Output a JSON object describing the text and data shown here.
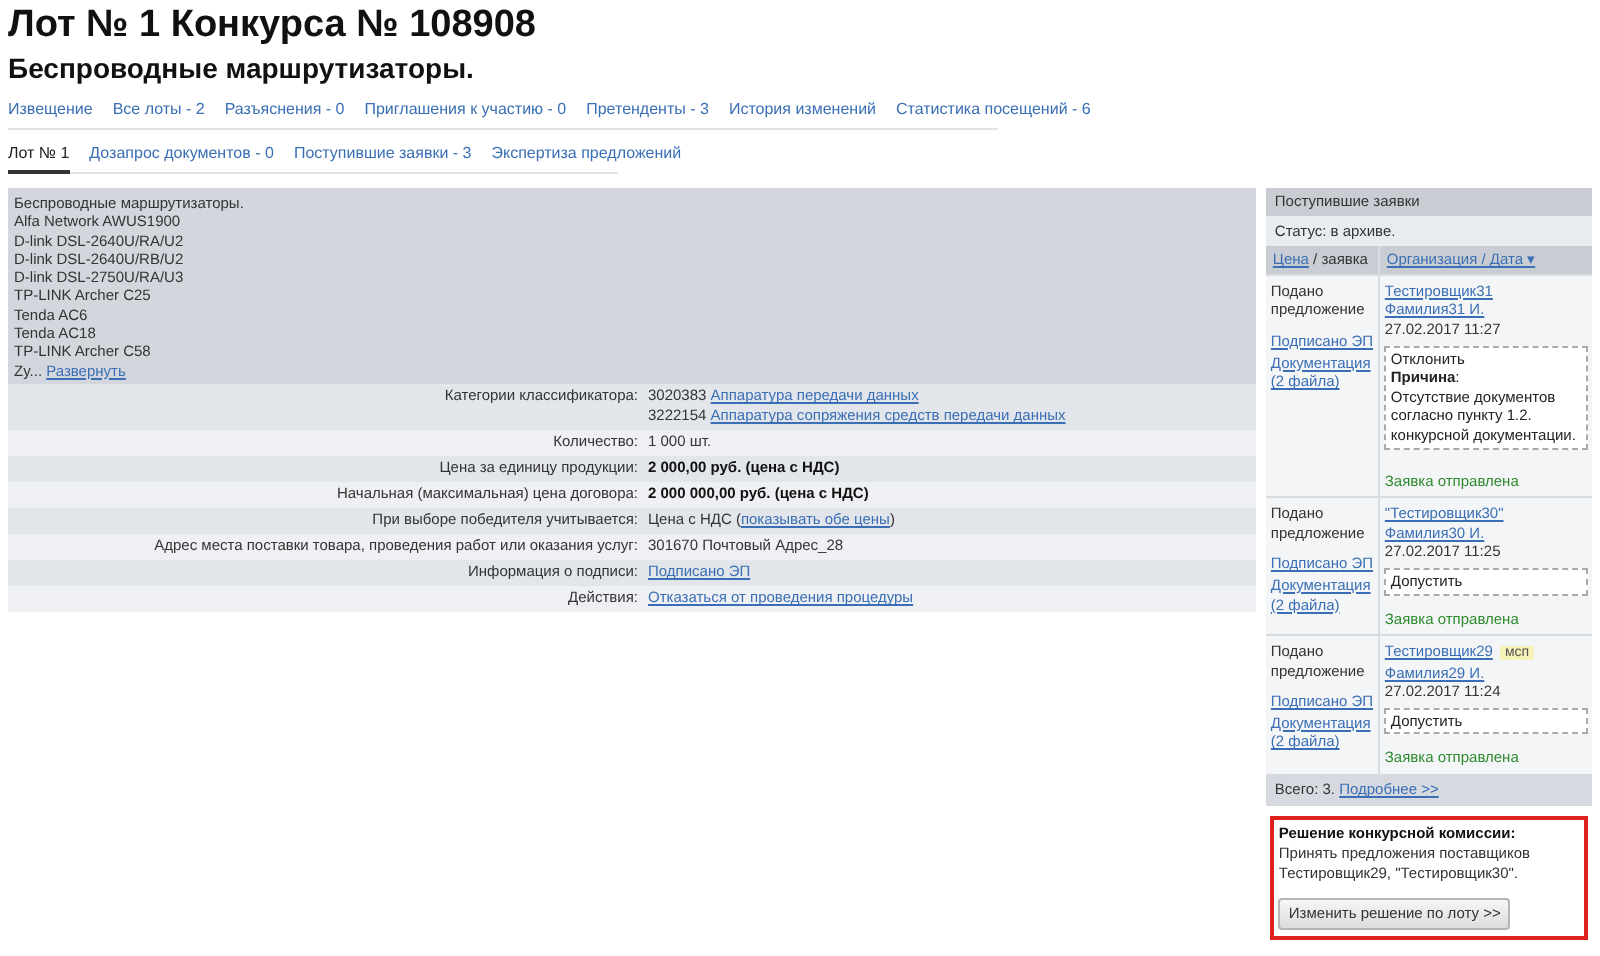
{
  "title": "Лот № 1 Конкурса № 108908",
  "subtitle": "Беспроводные маршрутизаторы.",
  "tabs": [
    {
      "label": "Извещение",
      "selected": false
    },
    {
      "label": "Все лоты - 2",
      "selected": false
    },
    {
      "label": "Разъяснения - 0",
      "selected": false
    },
    {
      "label": "Приглашения к участию - 0",
      "selected": false
    },
    {
      "label": "Претенденты - 3",
      "selected": false
    },
    {
      "label": "История изменений",
      "selected": false
    },
    {
      "label": "Статистика посещений - 6",
      "selected": false
    }
  ],
  "lot_tabs": [
    {
      "label": "Лот № 1",
      "selected": true
    },
    {
      "label": "Дозапрос документов - 0",
      "selected": false
    },
    {
      "label": "Поступившие заявки - 3",
      "selected": false
    },
    {
      "label": "Экспертиза предложений",
      "selected": false
    }
  ],
  "description": {
    "lines": [
      "Беспроводные маршрутизаторы.",
      "Alfa Network AWUS1900",
      "D-link DSL-2640U/RA/U2",
      "D-link DSL-2640U/RB/U2",
      "D-link DSL-2750U/RA/U3",
      "TP-LINK Archer C25",
      "Tenda AC6",
      "Tenda AC18",
      "TP-LINK Archer C58"
    ],
    "cut_text": "Zy...",
    "expand_link": "Развернуть"
  },
  "details": [
    {
      "label": "Категории классификатора:",
      "lines": [
        [
          {
            "kind": "text",
            "text": "3020383"
          },
          {
            "kind": "link",
            "text": "Аппаратура передачи данных"
          }
        ],
        [
          {
            "kind": "text",
            "text": "3222154"
          },
          {
            "kind": "link",
            "text": "Аппаратура сопряжения средств передачи данных"
          }
        ]
      ]
    },
    {
      "label": "Количество:",
      "lines": [
        [
          {
            "kind": "text",
            "text": "1 000 шт."
          }
        ]
      ]
    },
    {
      "label": "Цена за единицу продукции:",
      "lines": [
        [
          {
            "kind": "bold",
            "text": "2 000,00 руб. (цена с НДС)"
          }
        ]
      ]
    },
    {
      "label": "Начальная (максимальная) цена договора:",
      "lines": [
        [
          {
            "kind": "bold",
            "text": "2 000 000,00 руб. (цена с НДС)"
          }
        ]
      ]
    },
    {
      "label": "При выборе победителя учитывается:",
      "lines": [
        [
          {
            "kind": "text",
            "text": "Цена с НДС ("
          },
          {
            "kind": "link",
            "text": "показывать обе цены"
          },
          {
            "kind": "text",
            "text": ")"
          }
        ]
      ]
    },
    {
      "label": "Адрес места поставки товара, проведения работ или оказания услуг:",
      "lines": [
        [
          {
            "kind": "text",
            "text": "301670 Почтовый Адрес_28"
          }
        ]
      ]
    },
    {
      "label": "Информация о подписи:",
      "lines": [
        [
          {
            "kind": "link",
            "text": "Подписано ЭП"
          }
        ]
      ]
    },
    {
      "label": "Действия:",
      "lines": [
        [
          {
            "kind": "link",
            "text": "Отказаться от проведения процедуры"
          }
        ]
      ]
    }
  ],
  "bids_panel": {
    "header": "Поступившие заявки",
    "status": "Статус: в архиве.",
    "columns": [
      [
        {
          "kind": "link",
          "text": "Цена"
        },
        {
          "kind": "text",
          "text": " / заявка"
        }
      ],
      [
        {
          "kind": "link",
          "text": "Организация / Дата ▾"
        }
      ]
    ],
    "bids": [
      {
        "state": "Подано предложение",
        "signed": "Подписано ЭП",
        "docs": "Документация (2 файла)",
        "org": "Тестировщик31",
        "person": "Фамилия31 И.",
        "date": "27.02.2017 11:27",
        "decision": "Отклонить",
        "reason_label": "**Причина**:",
        "reason": "Отсутствие документов согласно пункту 1.2. конкурсной документации.",
        "status": "Заявка отправлена"
      },
      {
        "state": "Подано предложение",
        "signed": "Подписано ЭП",
        "docs": "Документация (2 файла)",
        "org": "\"Тестировщик30\"",
        "person": "Фамилия30 И.",
        "date": "27.02.2017 11:25",
        "decision": "Допустить",
        "status": "Заявка отправлена"
      },
      {
        "state": "Подано предложение",
        "signed": "Подписано ЭП",
        "docs": "Документация (2 файла)",
        "org": "Тестировщик29",
        "badge": "мсп",
        "person": "Фамилия29 И.",
        "date": "27.02.2017 11:24",
        "decision": "Допустить",
        "status": "Заявка отправлена"
      }
    ],
    "total": "Всего: 3.",
    "more_link": "Подробнее >>"
  },
  "commission": {
    "title": "Решение конкурсной комиссии:",
    "text": "Принять предложения поставщиков Тестировщик29, \"Тестировщик30\".",
    "button": "Изменить решение по лоту >>"
  }
}
